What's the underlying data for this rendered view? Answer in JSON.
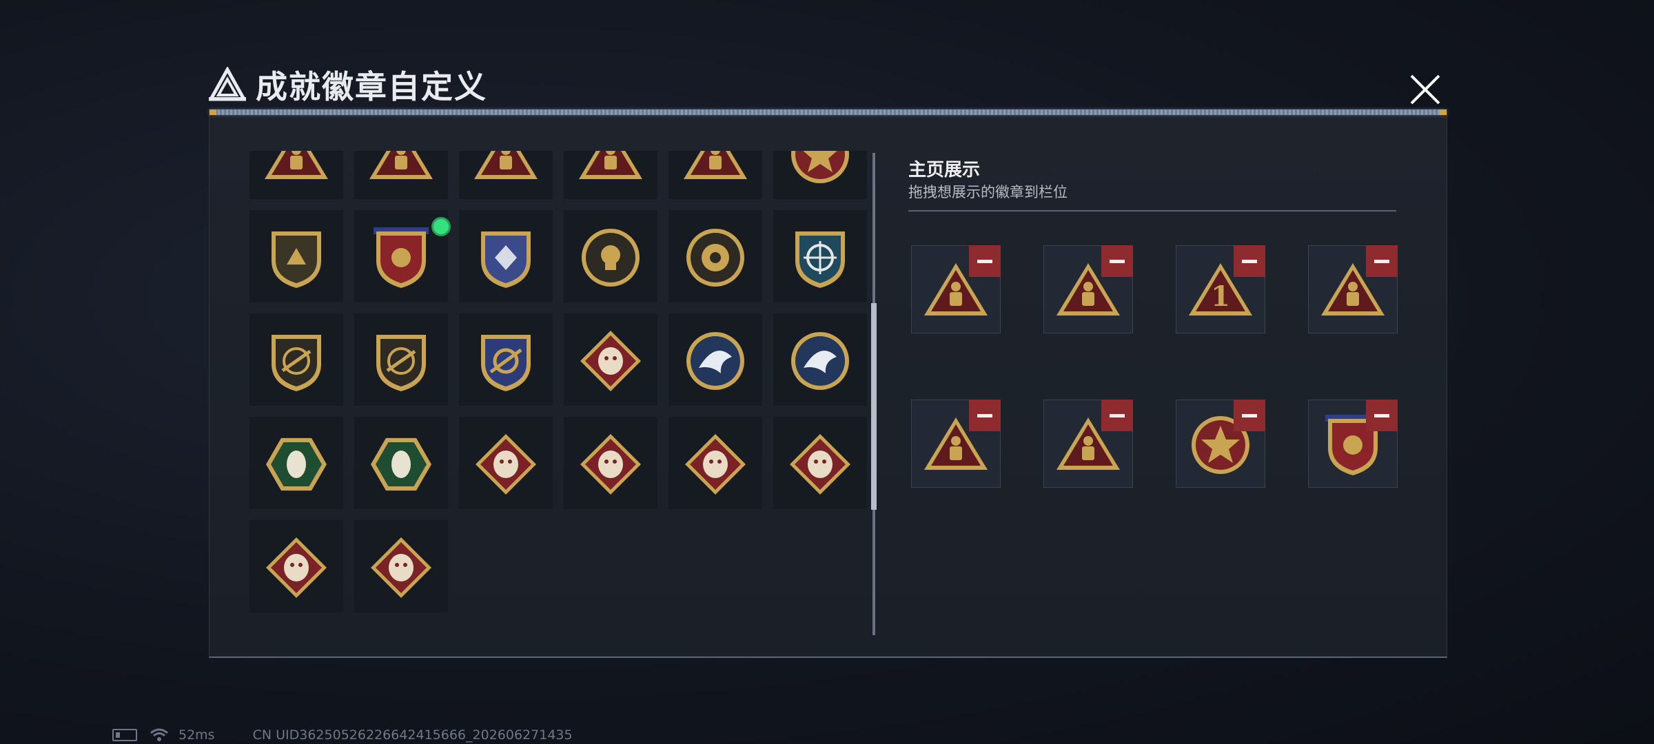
{
  "background": {
    "ghost_text": ""
  },
  "header": {
    "title": "成就徽章自定义",
    "logo_icon": "triangle-a-logo-icon",
    "close_icon": "close-icon"
  },
  "grid": {
    "rows": [
      [
        "triangle-red",
        "triangle-red",
        "triangle-red",
        "triangle-red",
        "triangle-red",
        "star-round-red"
      ],
      [
        "shield-dark",
        "shield-flag-red",
        "shield-wings-blue",
        "round-skull-dark",
        "round-shield-dark",
        "shield-crosshair-blue"
      ],
      [
        "shield-rifle-dark",
        "shield-sword-dark",
        "shield-gold-blue",
        "diamond-wolf-red",
        "round-eagle-blue",
        "round-eagle-blue"
      ],
      [
        "hex-wasp-green",
        "hex-runner-green",
        "diamond-dragon-red",
        "diamond-dragon-red",
        "diamond-runner-red",
        "diamond-gear-red"
      ],
      [
        "diamond-horse-red",
        "diamond-tools-red"
      ]
    ],
    "new_dots": [
      [
        1,
        1
      ]
    ],
    "partial_dots": [
      0,
      1,
      2,
      3,
      4,
      5
    ]
  },
  "showcase": {
    "title": "主页展示",
    "subtitle": "拖拽想展示的徽章到栏位",
    "slots": [
      "triangle-red",
      "triangle-red",
      "triangle-red-1",
      "triangle-red",
      "triangle-red",
      "triangle-red",
      "star-round-red",
      "shield-flag-red"
    ]
  },
  "status": {
    "ping": "52ms",
    "uid": "CN UID36250526226642415666_202606271435"
  },
  "colors": {
    "accent_red": "#8e2b2f",
    "gold": "#c9a553",
    "indicator_green": "#36e07f",
    "panel_bg": "#1e232c"
  }
}
